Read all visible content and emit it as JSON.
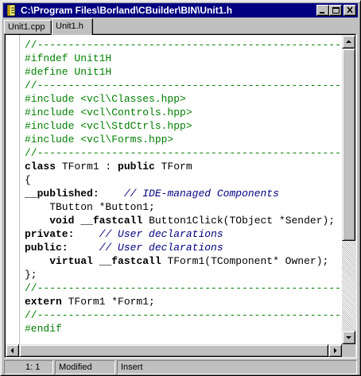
{
  "window": {
    "title": "C:\\Program Files\\Borland\\CBuilder\\BIN\\Unit1.h",
    "icons": {
      "app": "document-icon",
      "minimize": "minimize-icon",
      "maximize": "maximize-icon",
      "close": "close-icon"
    }
  },
  "tabs": [
    {
      "label": "Unit1.cpp",
      "active": false
    },
    {
      "label": "Unit1.h",
      "active": true
    }
  ],
  "editor": {
    "lines": [
      [
        {
          "t": "//-------------------------------------------------------",
          "c": "dir"
        }
      ],
      [
        {
          "t": "#ifndef Unit1H",
          "c": "dir"
        }
      ],
      [
        {
          "t": "#define Unit1H",
          "c": "dir"
        }
      ],
      [
        {
          "t": "//-------------------------------------------------------",
          "c": "dir"
        }
      ],
      [
        {
          "t": "#include <vcl\\Classes.hpp>",
          "c": "dir"
        }
      ],
      [
        {
          "t": "#include <vcl\\Controls.hpp>",
          "c": "dir"
        }
      ],
      [
        {
          "t": "#include <vcl\\StdCtrls.hpp>",
          "c": "dir"
        }
      ],
      [
        {
          "t": "#include <vcl\\Forms.hpp>",
          "c": "dir"
        }
      ],
      [
        {
          "t": "//-------------------------------------------------------",
          "c": "dir"
        }
      ],
      [
        {
          "t": "class",
          "c": "kw"
        },
        {
          "t": " TForm1 : ",
          "c": "plain"
        },
        {
          "t": "public",
          "c": "kw"
        },
        {
          "t": " TForm",
          "c": "plain"
        }
      ],
      [
        {
          "t": "{",
          "c": "plain"
        }
      ],
      [
        {
          "t": "__published:",
          "c": "kw"
        },
        {
          "t": "    ",
          "c": "plain"
        },
        {
          "t": "// IDE-managed Components",
          "c": "cmt"
        }
      ],
      [
        {
          "t": "    TButton *Button1;",
          "c": "plain"
        }
      ],
      [
        {
          "t": "    ",
          "c": "plain"
        },
        {
          "t": "void",
          "c": "kw"
        },
        {
          "t": " ",
          "c": "plain"
        },
        {
          "t": "__fastcall",
          "c": "kw"
        },
        {
          "t": " Button1Click(TObject *Sender);",
          "c": "plain"
        }
      ],
      [
        {
          "t": "private:",
          "c": "kw"
        },
        {
          "t": "    ",
          "c": "plain"
        },
        {
          "t": "// User declarations",
          "c": "cmt"
        }
      ],
      [
        {
          "t": "public:",
          "c": "kw"
        },
        {
          "t": "     ",
          "c": "plain"
        },
        {
          "t": "// User declarations",
          "c": "cmt"
        }
      ],
      [
        {
          "t": "    ",
          "c": "plain"
        },
        {
          "t": "virtual",
          "c": "kw"
        },
        {
          "t": " ",
          "c": "plain"
        },
        {
          "t": "__fastcall",
          "c": "kw"
        },
        {
          "t": " TForm1(TComponent* Owner);",
          "c": "plain"
        }
      ],
      [
        {
          "t": "};",
          "c": "plain"
        }
      ],
      [
        {
          "t": "//-------------------------------------------------------",
          "c": "dir"
        }
      ],
      [
        {
          "t": "extern",
          "c": "kw"
        },
        {
          "t": " TForm1 *Form1;",
          "c": "plain"
        }
      ],
      [
        {
          "t": "//-------------------------------------------------------",
          "c": "dir"
        }
      ],
      [
        {
          "t": "#endif",
          "c": "dir"
        }
      ]
    ]
  },
  "scrollbars": {
    "icons": {
      "up": "scroll-up-arrow-icon",
      "down": "scroll-down-arrow-icon",
      "left": "scroll-left-arrow-icon",
      "right": "scroll-right-arrow-icon"
    }
  },
  "status": {
    "position": "1:   1",
    "modified": "Modified",
    "mode": "Insert"
  },
  "colors": {
    "titlebar": "#000080",
    "directive": "#008000",
    "comment": "#000080",
    "face": "#c0c0c0"
  }
}
